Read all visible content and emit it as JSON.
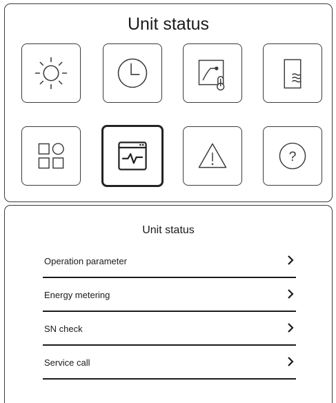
{
  "header": {
    "title": "Unit status"
  },
  "tiles": [
    {
      "icon": "sun-icon"
    },
    {
      "icon": "clock-icon"
    },
    {
      "icon": "temperature-curve-icon"
    },
    {
      "icon": "water-tank-icon"
    },
    {
      "icon": "apps-grid-icon"
    },
    {
      "icon": "monitor-pulse-icon",
      "selected": true
    },
    {
      "icon": "warning-icon"
    },
    {
      "icon": "help-icon"
    }
  ],
  "submenu": {
    "title": "Unit status",
    "items": [
      {
        "label": "Operation parameter",
        "icon": "chevron-right-icon"
      },
      {
        "label": "Energy metering",
        "icon": "chevron-right-icon"
      },
      {
        "label": "SN check",
        "icon": "chevron-right-icon"
      },
      {
        "label": "Service call",
        "icon": "chevron-right-icon"
      }
    ]
  },
  "colors": {
    "stroke": "#3a3a3a",
    "text": "#1a1a1a",
    "background": "#ffffff"
  }
}
